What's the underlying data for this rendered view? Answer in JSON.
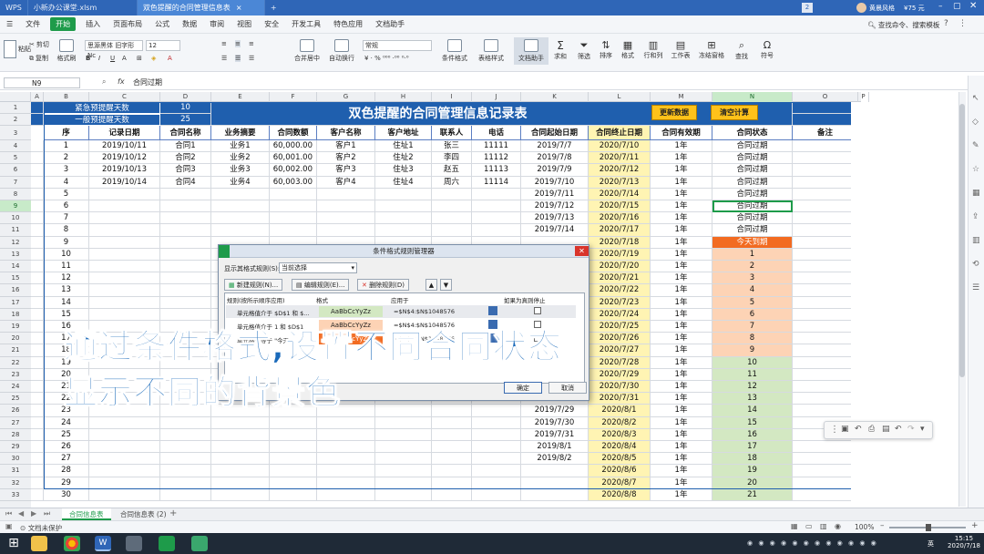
{
  "window": {
    "tabs": [
      "WPS",
      "小新办公课堂.xlsm",
      "双色提醒的合同管理信息表"
    ],
    "user": "黄晨风格",
    "badge": "2",
    "notice": "¥75 元"
  },
  "menu": {
    "items": [
      "文件",
      "开始",
      "插入",
      "页面布局",
      "公式",
      "数据",
      "审阅",
      "视图",
      "安全",
      "开发工具",
      "特色应用",
      "文档助手"
    ],
    "search": "查找命令、搜索模板"
  },
  "ribbon": {
    "cut": "剪切",
    "copy": "复制",
    "paste": "粘贴",
    "format_painter": "格式刷",
    "font": "思源黑体 旧字形 Nc",
    "size": "12",
    "number_format": "常规",
    "merge": "合并居中",
    "wrap": "自动换行",
    "cond_format": "条件格式",
    "table_style": "表格样式",
    "doc_helper": "文档助手",
    "sum": "求和",
    "filter": "筛选",
    "sort": "排序",
    "format": "格式",
    "row_col": "行和列",
    "sheet": "工作表",
    "freeze": "冻结窗格",
    "find": "查找",
    "symbol": "符号"
  },
  "formula_bar": {
    "name_box": "N9",
    "fx": "fx",
    "content": "合同过期"
  },
  "columns": [
    "A",
    "B",
    "C",
    "D",
    "E",
    "F",
    "G",
    "H",
    "I",
    "J",
    "K",
    "L",
    "M",
    "N",
    "O",
    "P"
  ],
  "sheet": {
    "title": "双色提醒的合同管理信息记录表",
    "urgent_label": "紧急预提醒天数",
    "urgent_value": "10",
    "normal_label": "一般预提醒天数",
    "normal_value": "25",
    "btn_update": "更新数据",
    "btn_clear": "清空计算",
    "headers": [
      "序",
      "记录日期",
      "合同名称",
      "业务摘要",
      "合同数额",
      "客户名称",
      "客户地址",
      "联系人",
      "电话",
      "合同起始日期",
      "合同终止日期",
      "合同有效期",
      "合同状态",
      "备注"
    ],
    "rows": [
      [
        "1",
        "2019/10/11",
        "合同1",
        "业务1",
        "60,000.00",
        "客户1",
        "住址1",
        "张三",
        "11111",
        "2019/7/7",
        "2020/7/10",
        "1年",
        "合同过期"
      ],
      [
        "2",
        "2019/10/12",
        "合同2",
        "业务2",
        "60,001.00",
        "客户2",
        "住址2",
        "李四",
        "11112",
        "2019/7/8",
        "2020/7/11",
        "1年",
        "合同过期"
      ],
      [
        "3",
        "2019/10/13",
        "合同3",
        "业务3",
        "60,002.00",
        "客户3",
        "住址3",
        "赵五",
        "11113",
        "2019/7/9",
        "2020/7/12",
        "1年",
        "合同过期"
      ],
      [
        "4",
        "2019/10/14",
        "合同4",
        "业务4",
        "60,003.00",
        "客户4",
        "住址4",
        "周六",
        "11114",
        "2019/7/10",
        "2020/7/13",
        "1年",
        "合同过期"
      ],
      [
        "5",
        "",
        "",
        "",
        "",
        "",
        "",
        "",
        "",
        "2019/7/11",
        "2020/7/14",
        "1年",
        "合同过期"
      ],
      [
        "6",
        "",
        "",
        "",
        "",
        "",
        "",
        "",
        "",
        "2019/7/12",
        "2020/7/15",
        "1年",
        "合同过期"
      ],
      [
        "7",
        "",
        "",
        "",
        "",
        "",
        "",
        "",
        "",
        "2019/7/13",
        "2020/7/16",
        "1年",
        "合同过期"
      ],
      [
        "8",
        "",
        "",
        "",
        "",
        "",
        "",
        "",
        "",
        "2019/7/14",
        "2020/7/17",
        "1年",
        "合同过期"
      ],
      [
        "9",
        "",
        "",
        "",
        "",
        "",
        "",
        "",
        "",
        "",
        "2020/7/18",
        "1年",
        "今天到期"
      ],
      [
        "10",
        "",
        "",
        "",
        "",
        "",
        "",
        "",
        "",
        "",
        "2020/7/19",
        "1年",
        "1"
      ],
      [
        "11",
        "",
        "",
        "",
        "",
        "",
        "",
        "",
        "",
        "",
        "2020/7/20",
        "1年",
        "2"
      ],
      [
        "12",
        "",
        "",
        "",
        "",
        "",
        "",
        "",
        "",
        "",
        "2020/7/21",
        "1年",
        "3"
      ],
      [
        "13",
        "",
        "",
        "",
        "",
        "",
        "",
        "",
        "",
        "",
        "2020/7/22",
        "1年",
        "4"
      ],
      [
        "14",
        "",
        "",
        "",
        "",
        "",
        "",
        "",
        "",
        "",
        "2020/7/23",
        "1年",
        "5"
      ],
      [
        "15",
        "",
        "",
        "",
        "",
        "",
        "",
        "",
        "",
        "",
        "2020/7/24",
        "1年",
        "6"
      ],
      [
        "16",
        "",
        "",
        "",
        "",
        "",
        "",
        "",
        "",
        "",
        "2020/7/25",
        "1年",
        "7"
      ],
      [
        "17",
        "",
        "",
        "",
        "",
        "",
        "",
        "",
        "",
        "",
        "2020/7/26",
        "1年",
        "8"
      ],
      [
        "18",
        "",
        "",
        "",
        "",
        "",
        "",
        "",
        "",
        "",
        "2020/7/27",
        "1年",
        "9"
      ],
      [
        "19",
        "",
        "",
        "",
        "",
        "",
        "",
        "",
        "",
        "",
        "2020/7/28",
        "1年",
        "10"
      ],
      [
        "20",
        "",
        "",
        "",
        "",
        "",
        "",
        "",
        "",
        "",
        "2020/7/29",
        "1年",
        "11"
      ],
      [
        "21",
        "",
        "",
        "",
        "",
        "",
        "",
        "",
        "",
        "",
        "2020/7/30",
        "1年",
        "12"
      ],
      [
        "22",
        "",
        "",
        "",
        "",
        "",
        "",
        "",
        "",
        "2019/7/28",
        "2020/7/31",
        "1年",
        "13"
      ],
      [
        "23",
        "",
        "",
        "",
        "",
        "",
        "",
        "",
        "",
        "2019/7/29",
        "2020/8/1",
        "1年",
        "14"
      ],
      [
        "24",
        "",
        "",
        "",
        "",
        "",
        "",
        "",
        "",
        "2019/7/30",
        "2020/8/2",
        "1年",
        "15"
      ],
      [
        "25",
        "",
        "",
        "",
        "",
        "",
        "",
        "",
        "",
        "2019/7/31",
        "2020/8/3",
        "1年",
        "16"
      ],
      [
        "26",
        "",
        "",
        "",
        "",
        "",
        "",
        "",
        "",
        "2019/8/1",
        "2020/8/4",
        "1年",
        "17"
      ],
      [
        "27",
        "",
        "",
        "",
        "",
        "",
        "",
        "",
        "",
        "2019/8/2",
        "2020/8/5",
        "1年",
        "18"
      ],
      [
        "28",
        "",
        "",
        "",
        "",
        "",
        "",
        "",
        "",
        "",
        "2020/8/6",
        "1年",
        "19"
      ],
      [
        "29",
        "",
        "",
        "",
        "",
        "",
        "",
        "",
        "",
        "",
        "2020/8/7",
        "1年",
        "20"
      ],
      [
        "30",
        "",
        "",
        "",
        "",
        "",
        "",
        "",
        "",
        "",
        "2020/8/8",
        "1年",
        "21"
      ]
    ]
  },
  "dialog": {
    "title": "条件格式规则管理器",
    "show_label": "显示其格式规则(S):",
    "show_value": "当前选择",
    "btn_new": "新建规则(N)...",
    "btn_edit": "编辑规则(E)...",
    "btn_delete": "删除规则(D)",
    "col_rule": "规则(按所示顺序应用)",
    "col_format": "格式",
    "col_apply": "应用于",
    "col_stop": "如果为真则停止",
    "rules": [
      {
        "rule": "单元格值介于 $D$1 和 $...",
        "preview": "AaBbCcYyZz",
        "apply": "=$N$4:$N$1048576"
      },
      {
        "rule": "单元格值介于 1 和 $D$1",
        "preview": "AaBbCcYyZz",
        "apply": "=$N$4:$N$1048576"
      },
      {
        "rule": "单元格值等于 \"今天...",
        "preview": "AaBbCcYyZz",
        "apply": "=$N$4:$N$1048576"
      }
    ],
    "btn_ok": "确定",
    "btn_cancel": "取消"
  },
  "overlay": {
    "line1": "通过条件格式,设置不同合同状态",
    "line2": "显示不同的背景色"
  },
  "sheet_tabs": [
    "合同信息表",
    "合同信息表 (2)"
  ],
  "status": {
    "left": "文档未保护",
    "zoom": "100%"
  },
  "taskbar": {
    "time": "15:15",
    "date": "2020/7/18",
    "lang": "英"
  },
  "colors": {
    "title_blue": "#2f66b7",
    "accent_green": "#1e9b4a",
    "term_yellow": "#fff4b3",
    "due_orange": "#f26b21",
    "soon_peach": "#fdd3b5",
    "later_green": "#d3e8c2"
  }
}
